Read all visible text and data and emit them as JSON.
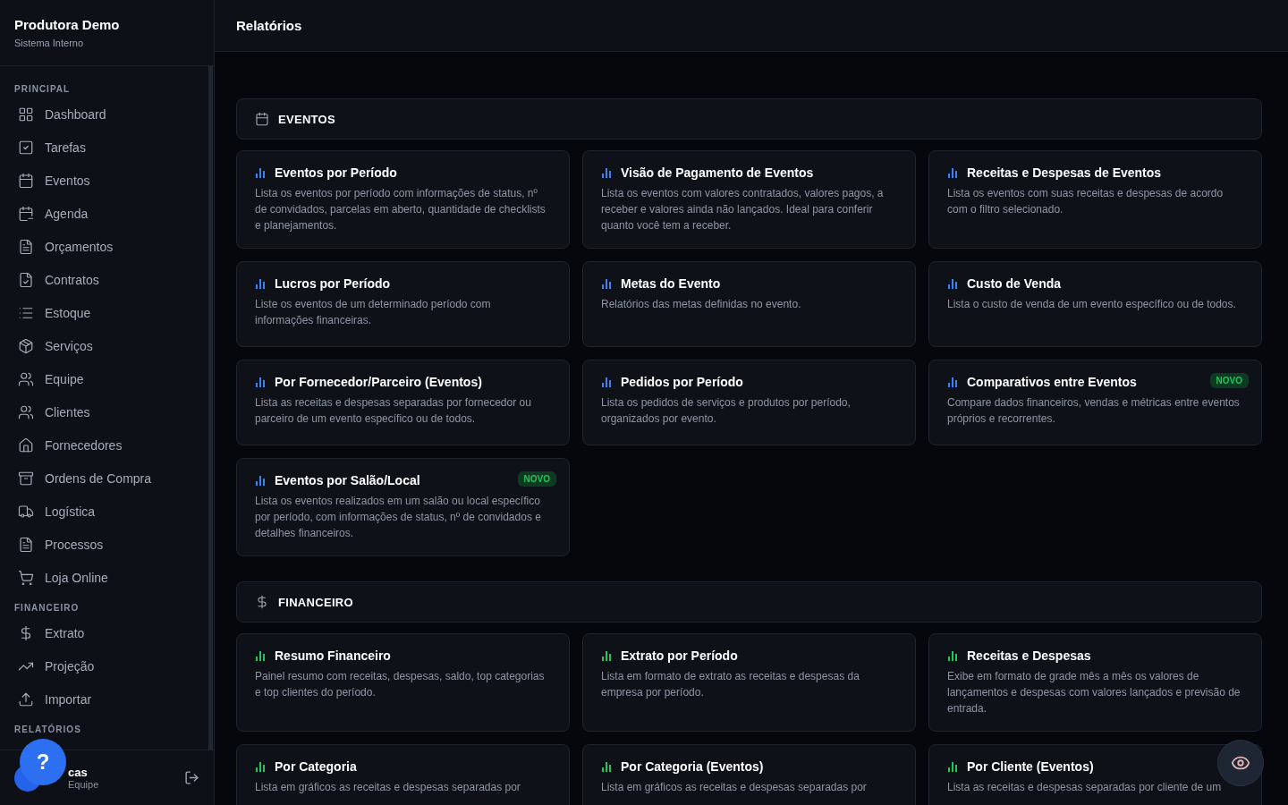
{
  "brand": {
    "title": "Produtora Demo",
    "subtitle": "Sistema Interno"
  },
  "sidebar": {
    "groups": [
      {
        "label": "PRINCIPAL",
        "items": [
          {
            "label": "Dashboard"
          },
          {
            "label": "Tarefas"
          },
          {
            "label": "Eventos"
          },
          {
            "label": "Agenda"
          },
          {
            "label": "Orçamentos"
          },
          {
            "label": "Contratos"
          },
          {
            "label": "Estoque"
          },
          {
            "label": "Serviços"
          },
          {
            "label": "Equipe"
          },
          {
            "label": "Clientes"
          },
          {
            "label": "Fornecedores"
          },
          {
            "label": "Ordens de Compra"
          },
          {
            "label": "Logística"
          },
          {
            "label": "Processos"
          },
          {
            "label": "Loja Online"
          }
        ]
      },
      {
        "label": "FINANCEIRO",
        "items": [
          {
            "label": "Extrato"
          },
          {
            "label": "Projeção"
          },
          {
            "label": "Importar"
          }
        ]
      },
      {
        "label": "RELATÓRIOS"
      }
    ]
  },
  "user": {
    "name": "cas",
    "role": "Equipe"
  },
  "header": {
    "title": "Relatórios"
  },
  "sections": [
    {
      "title": "EVENTOS",
      "color": "#3b82f6",
      "cards": [
        {
          "title": "Eventos por Período",
          "description": "Lista os eventos por período com informações de status, nº de convidados, parcelas em aberto, quantidade de checklists e planejamentos.",
          "new": false
        },
        {
          "title": "Visão de Pagamento de Eventos",
          "description": "Lista os eventos com valores contratados, valores pagos, a receber e valores ainda não lançados. Ideal para conferir quanto você tem a receber.",
          "new": false
        },
        {
          "title": "Receitas e Despesas de Eventos",
          "description": "Lista os eventos com suas receitas e despesas de acordo com o filtro selecionado.",
          "new": false
        },
        {
          "title": "Lucros por Período",
          "description": "Liste os eventos de um determinado período com informações financeiras.",
          "new": false
        },
        {
          "title": "Metas do Evento",
          "description": "Relatórios das metas definidas no evento.",
          "new": false
        },
        {
          "title": "Custo de Venda",
          "description": "Lista o custo de venda de um evento específico ou de todos.",
          "new": false
        },
        {
          "title": "Por Fornecedor/Parceiro (Eventos)",
          "description": "Lista as receitas e despesas separadas por fornecedor ou parceiro de um evento específico ou de todos.",
          "new": false
        },
        {
          "title": "Pedidos por Período",
          "description": "Lista os pedidos de serviços e produtos por período, organizados por evento.",
          "new": false
        },
        {
          "title": "Comparativos entre Eventos",
          "description": "Compare dados financeiros, vendas e métricas entre eventos próprios e recorrentes.",
          "new": true,
          "badge": "NOVO"
        },
        {
          "title": "Eventos por Salão/Local",
          "description": "Lista os eventos realizados em um salão ou local específico por período, com informações de status, nº de convidados e detalhes financeiros.",
          "new": true,
          "badge": "NOVO"
        }
      ]
    },
    {
      "title": "FINANCEIRO",
      "color": "#22c55e",
      "cards": [
        {
          "title": "Resumo Financeiro",
          "description": "Painel resumo com receitas, despesas, saldo, top categorias e top clientes do período.",
          "new": false
        },
        {
          "title": "Extrato por Período",
          "description": "Lista em formato de extrato as receitas e despesas da empresa por período.",
          "new": false
        },
        {
          "title": "Receitas e Despesas",
          "description": "Exibe em formato de grade mês a mês os valores de lançamentos e despesas com valores lançados e previsão de entrada.",
          "new": false
        },
        {
          "title": "Por Categoria",
          "description": "Lista em gráficos as receitas e despesas separadas por",
          "new": false
        },
        {
          "title": "Por Categoria (Eventos)",
          "description": "Lista em gráficos as receitas e despesas separadas por",
          "new": false
        },
        {
          "title": "Por Cliente (Eventos)",
          "description": "Lista as receitas e despesas separadas por cliente de um",
          "new": false
        }
      ]
    }
  ],
  "help": {
    "label": "?"
  }
}
